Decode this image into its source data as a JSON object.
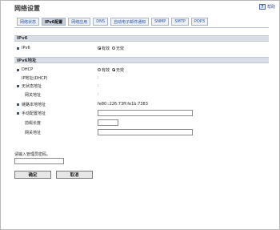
{
  "header": {
    "title": "网络设置",
    "help_label": "帮助",
    "help_icon_glyph": "?"
  },
  "tabs": [
    {
      "label": "网络状态",
      "active": false
    },
    {
      "label": "IPv6配置",
      "active": true
    },
    {
      "label": "网络应用",
      "active": false
    },
    {
      "label": "DNS",
      "active": false
    },
    {
      "label": "自动电子邮件通知",
      "active": false
    },
    {
      "label": "SNMP",
      "active": false
    },
    {
      "label": "SMTP",
      "active": false
    },
    {
      "label": "POP3",
      "active": false
    }
  ],
  "ipv6_section": {
    "title": "IPv6",
    "ipv6_label": "IPv6",
    "enable_label": "有效",
    "disable_label": "无效",
    "selected": "enable"
  },
  "address_section": {
    "title": "IPv6地址",
    "dhcp_label": "DHCP",
    "dhcp_enable_label": "有效",
    "dhcp_disable_label": "无效",
    "dhcp_selected": "disable",
    "dhcp_address_label": "IP地址(DHCP)",
    "dhcp_address_value": "",
    "stateless_label": "无状态地址",
    "stateless_value": "",
    "stateless_gateway_label": "网关地址",
    "stateless_gateway_value": "",
    "link_local_label": "链路本地地址",
    "link_local_value": "fe80::226:73ff:fe1b:7383",
    "manual_label": "手动配置地址",
    "manual_value": "",
    "prefix_label": "前缀长度",
    "prefix_value": "",
    "gateway_label": "网关地址",
    "gateway_value": ""
  },
  "footer": {
    "password_prompt": "请输入管理员密码。",
    "password_value": "",
    "ok_label": "确定",
    "cancel_label": "取消"
  },
  "colors": {
    "tab_text": "#2856a8",
    "section_bg": "#d8dde6",
    "bullet": "#3d4f7a"
  }
}
